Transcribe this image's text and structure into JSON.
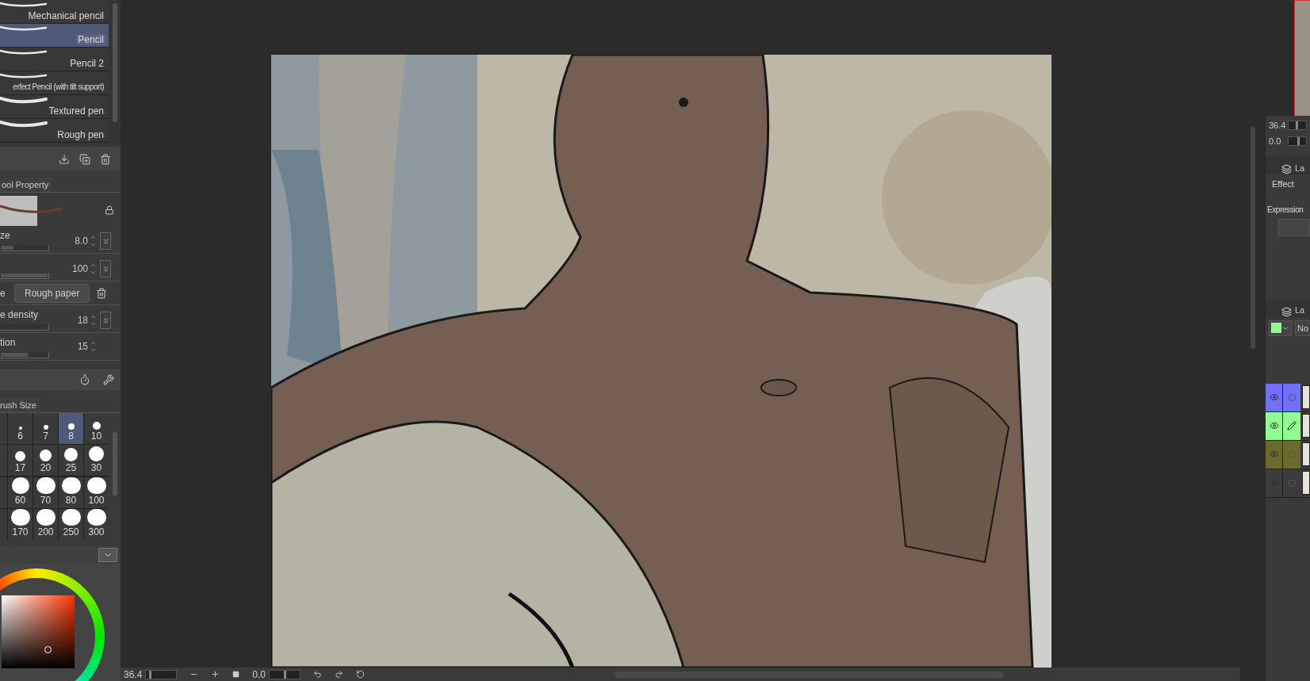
{
  "brushes": [
    {
      "label": "Mechanical pencil",
      "selected": false
    },
    {
      "label": "Pencil",
      "selected": true
    },
    {
      "label": "Pencil 2",
      "selected": false
    },
    {
      "label": "erfect Pencil (with tilt support)",
      "selected": false
    },
    {
      "label": "Textured pen",
      "selected": false
    },
    {
      "label": "Rough pen",
      "selected": false
    }
  ],
  "tool_property": {
    "tab": "ool Property",
    "rows": [
      {
        "kind": "slider",
        "label": "ze",
        "value": "8.0",
        "level": 0.27
      },
      {
        "kind": "slider",
        "label": "",
        "value": "100",
        "level": 1
      },
      {
        "kind": "texture",
        "label": "e",
        "button": "Rough paper"
      },
      {
        "kind": "slider",
        "label": "e density",
        "value": "18"
      },
      {
        "kind": "slider",
        "label": "tion",
        "value": "15",
        "level": 0.57
      }
    ]
  },
  "brush_size": {
    "tab": "rush Size",
    "rows": [
      [
        {
          "label": "6",
          "selected": false
        },
        {
          "label": "7",
          "selected": false
        },
        {
          "label": "8",
          "selected": true
        },
        {
          "label": "10",
          "selected": false
        }
      ],
      [
        {
          "label": "17",
          "selected": false
        },
        {
          "label": "20",
          "selected": false
        },
        {
          "label": "25",
          "selected": false
        },
        {
          "label": "30",
          "selected": false
        }
      ],
      [
        {
          "label": "60",
          "selected": false
        },
        {
          "label": "70",
          "selected": false
        },
        {
          "label": "80",
          "selected": false
        },
        {
          "label": "100",
          "selected": false
        }
      ],
      [
        {
          "label": "170",
          "selected": false
        },
        {
          "label": "200",
          "selected": false
        },
        {
          "label": "250",
          "selected": false
        },
        {
          "label": "300",
          "selected": false
        }
      ]
    ]
  },
  "status_bar": {
    "zoom": {
      "text": "36.4",
      "level": 0.1
    },
    "rotation": {
      "text": "0.0",
      "level": 0.5
    }
  },
  "navigator": {
    "zoom": {
      "text": "36.4",
      "level": 0.45
    },
    "rotation": {
      "text": "0.0",
      "level": 0.5
    }
  },
  "layer_property": {
    "tab": "La",
    "effect": "Effect",
    "expression": "Expression"
  },
  "layers_panel": {
    "tab": "La",
    "blend_mode": "No",
    "layers": [
      {
        "color": "#7070f8",
        "editing": false
      },
      {
        "color": "#92fa92",
        "editing": true
      },
      {
        "color": "#6a6a2c",
        "editing": false
      },
      {
        "color": "#3c3c3c",
        "editing": false
      }
    ]
  }
}
